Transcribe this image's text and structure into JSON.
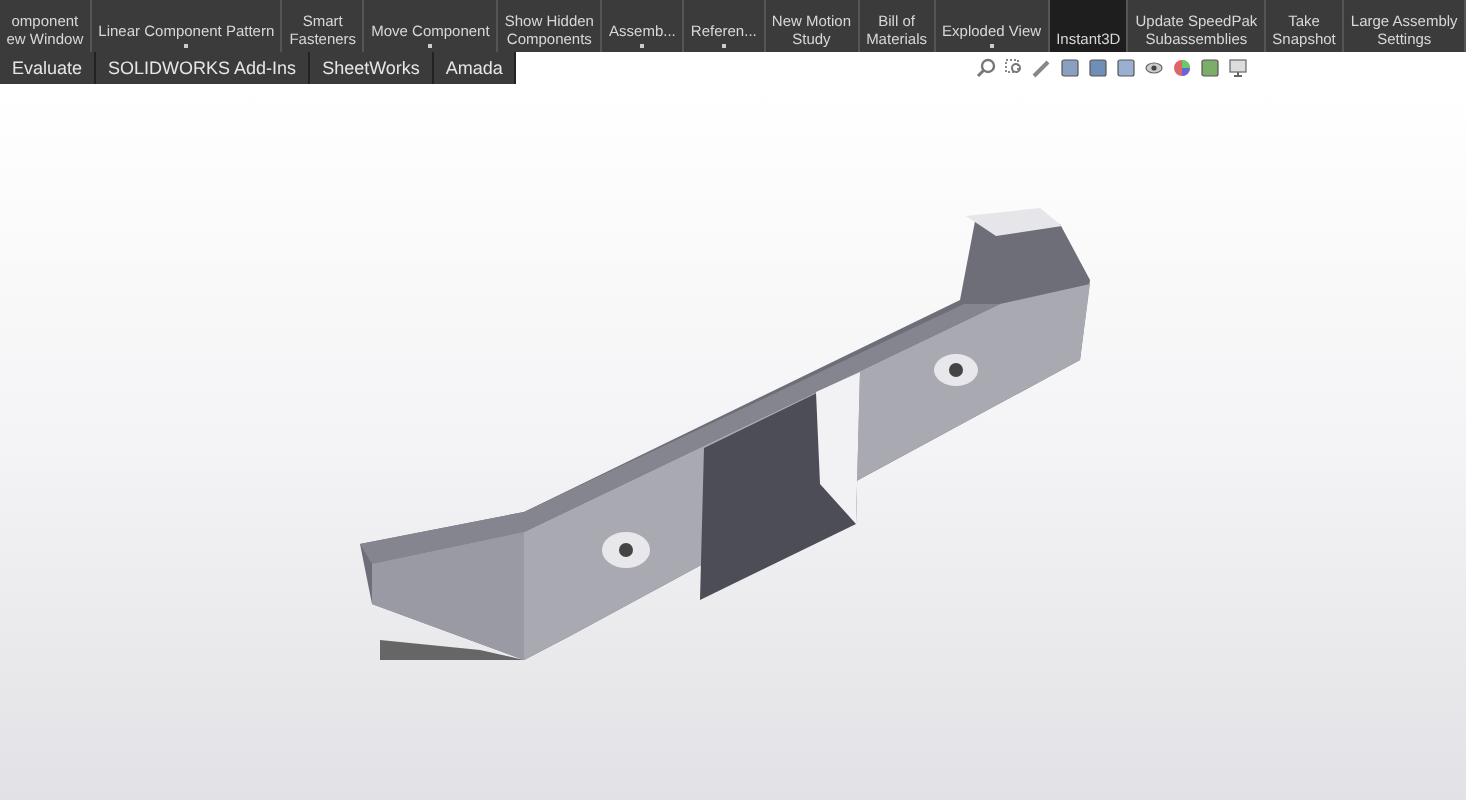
{
  "ribbon": {
    "buttons": [
      {
        "lines": [
          "omponent",
          "ew Window"
        ],
        "dropdown": false,
        "selected": false
      },
      {
        "lines": [
          "Linear Component Pattern"
        ],
        "dropdown": true,
        "selected": false
      },
      {
        "lines": [
          "Smart",
          "Fasteners"
        ],
        "dropdown": false,
        "selected": false
      },
      {
        "lines": [
          "Move Component"
        ],
        "dropdown": true,
        "selected": false
      },
      {
        "lines": [
          "Show Hidden",
          "Components"
        ],
        "dropdown": false,
        "selected": false
      },
      {
        "lines": [
          "Assemb..."
        ],
        "dropdown": true,
        "selected": false
      },
      {
        "lines": [
          "Referen..."
        ],
        "dropdown": true,
        "selected": false
      },
      {
        "lines": [
          "New Motion",
          "Study"
        ],
        "dropdown": false,
        "selected": false
      },
      {
        "lines": [
          "Bill of",
          "Materials"
        ],
        "dropdown": false,
        "selected": false
      },
      {
        "lines": [
          "Exploded View"
        ],
        "dropdown": true,
        "selected": false
      },
      {
        "lines": [
          "Instant3D"
        ],
        "dropdown": false,
        "selected": true
      },
      {
        "lines": [
          "Update SpeedPak",
          "Subassemblies"
        ],
        "dropdown": false,
        "selected": false
      },
      {
        "lines": [
          "Take",
          "Snapshot"
        ],
        "dropdown": false,
        "selected": false
      },
      {
        "lines": [
          "Large Assembly",
          "Settings"
        ],
        "dropdown": false,
        "selected": false
      }
    ]
  },
  "tabs": [
    {
      "label": "Evaluate"
    },
    {
      "label": "SOLIDWORKS Add-Ins"
    },
    {
      "label": "SheetWorks"
    },
    {
      "label": "Amada"
    }
  ]
}
